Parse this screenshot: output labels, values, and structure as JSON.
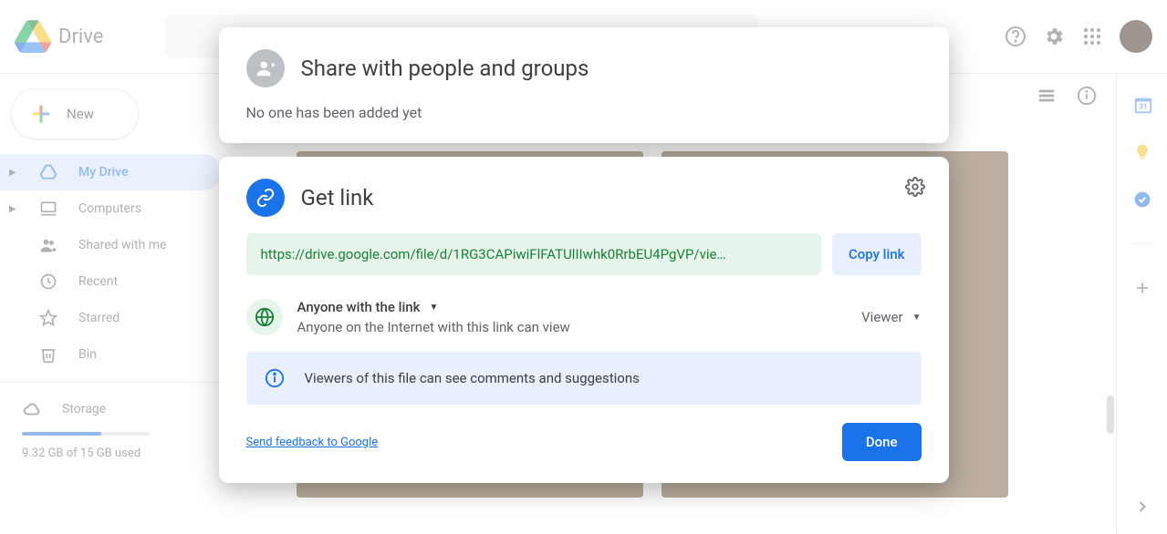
{
  "header": {
    "app_name": "Drive"
  },
  "sidebar": {
    "new_label": "New",
    "items": [
      {
        "label": "My Drive",
        "active": true,
        "chev": true,
        "icon": "drive"
      },
      {
        "label": "Computers",
        "active": false,
        "chev": true,
        "icon": "computer"
      },
      {
        "label": "Shared with me",
        "active": false,
        "chev": false,
        "icon": "people"
      },
      {
        "label": "Recent",
        "active": false,
        "chev": false,
        "icon": "clock"
      },
      {
        "label": "Starred",
        "active": false,
        "chev": false,
        "icon": "star"
      },
      {
        "label": "Bin",
        "active": false,
        "chev": false,
        "icon": "trash"
      }
    ],
    "storage_label": "Storage",
    "storage_used": "9.32 GB of 15 GB used",
    "storage_pct": 62
  },
  "share_modal": {
    "title": "Share with people and groups",
    "subtitle": "No one has been added yet"
  },
  "link_modal": {
    "title": "Get link",
    "url": "https://drive.google.com/file/d/1RG3CAPiwiFlFATUlIIwhk0RrbEU4PgVP/vie…",
    "copy_label": "Copy link",
    "access_title": "Anyone with the link",
    "access_desc": "Anyone on the Internet with this link can view",
    "role": "Viewer",
    "info_text": "Viewers of this file can see comments and suggestions",
    "feedback": "Send feedback to Google",
    "done": "Done"
  },
  "rside": {
    "calendar_day": "31"
  }
}
